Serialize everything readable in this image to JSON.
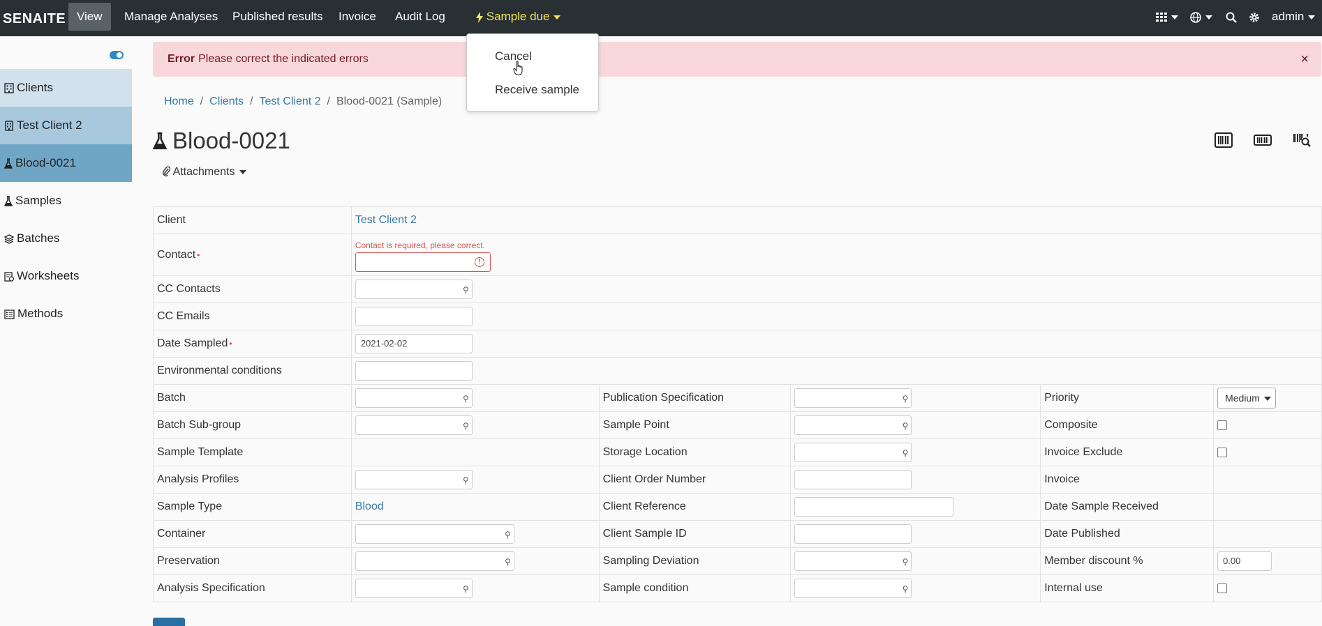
{
  "navbar": {
    "brand": "SENAITE",
    "items": [
      "View",
      "Manage Analyses",
      "Published results",
      "Invoice",
      "Audit Log"
    ],
    "state_label": "Sample due",
    "user": "admin"
  },
  "dropdown": {
    "items": [
      "Cancel",
      "Receive sample"
    ]
  },
  "sidebar": {
    "items": [
      {
        "label": "Clients",
        "icon": "building-icon"
      },
      {
        "label": "Test Client 2",
        "icon": "building-icon"
      },
      {
        "label": "Blood-0021",
        "icon": "flask-icon"
      },
      {
        "label": "Samples",
        "icon": "flask-icon"
      },
      {
        "label": "Batches",
        "icon": "layers-icon"
      },
      {
        "label": "Worksheets",
        "icon": "worksheet-icon"
      },
      {
        "label": "Methods",
        "icon": "list-icon"
      }
    ]
  },
  "alert": {
    "title": "Error",
    "message": "Please correct the indicated errors"
  },
  "breadcrumb": {
    "home": "Home",
    "clients": "Clients",
    "client": "Test Client 2",
    "current": "Blood-0021 (Sample)"
  },
  "page": {
    "title": "Blood-0021",
    "attachments": "Attachments"
  },
  "form": {
    "client_label": "Client",
    "client_value": "Test Client 2",
    "contact_label": "Contact",
    "contact_error": "Contact is required, please correct.",
    "cc_contacts_label": "CC Contacts",
    "cc_emails_label": "CC Emails",
    "date_sampled_label": "Date Sampled",
    "date_sampled_value": "2021-02-02",
    "env_conditions_label": "Environmental conditions",
    "batch_label": "Batch",
    "batch_subgroup_label": "Batch Sub-group",
    "sample_template_label": "Sample Template",
    "analysis_profiles_label": "Analysis Profiles",
    "sample_type_label": "Sample Type",
    "sample_type_value": "Blood",
    "container_label": "Container",
    "preservation_label": "Preservation",
    "analysis_spec_label": "Analysis Specification",
    "publication_spec_label": "Publication Specification",
    "sample_point_label": "Sample Point",
    "storage_location_label": "Storage Location",
    "client_order_label": "Client Order Number",
    "client_reference_label": "Client Reference",
    "client_sample_id_label": "Client Sample ID",
    "sampling_deviation_label": "Sampling Deviation",
    "sample_condition_label": "Sample condition",
    "priority_label": "Priority",
    "priority_value": "Medium",
    "composite_label": "Composite",
    "invoice_exclude_label": "Invoice Exclude",
    "invoice_label": "Invoice",
    "date_received_label": "Date Sample Received",
    "date_published_label": "Date Published",
    "member_discount_label": "Member discount %",
    "member_discount_value": "0.00",
    "internal_use_label": "Internal use"
  }
}
